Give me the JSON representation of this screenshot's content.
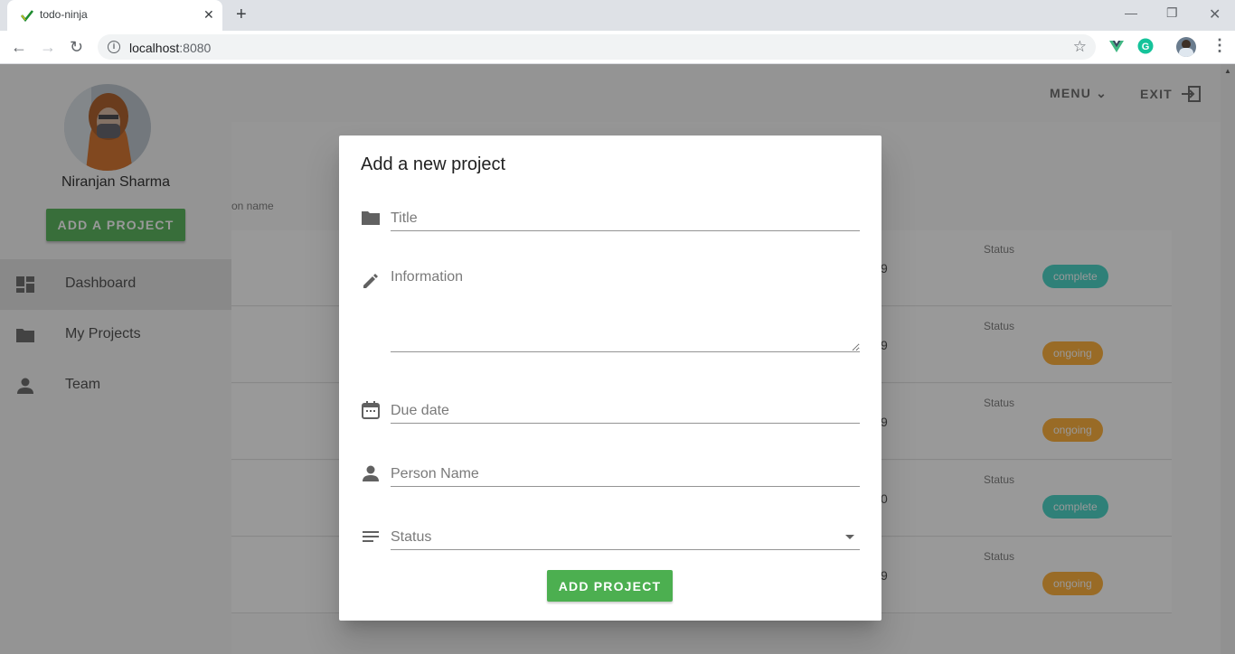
{
  "browser": {
    "tab_title": "todo-ninja",
    "url_host": "localhost",
    "url_port": ":8080"
  },
  "app": {
    "menu_label": "MENU",
    "exit_label": "EXIT",
    "column_header": "on name",
    "rows": [
      {
        "status_label": "Status",
        "date_fragment": "9",
        "status": "complete"
      },
      {
        "status_label": "Status",
        "date_fragment": "9",
        "status": "ongoing"
      },
      {
        "status_label": "Status",
        "date_fragment": "9",
        "status": "ongoing"
      },
      {
        "status_label": "Status",
        "date_fragment": "0",
        "status": "complete"
      },
      {
        "status_label": "Status",
        "date_fragment": "9",
        "status": "ongoing"
      }
    ]
  },
  "drawer": {
    "user_name": "Niranjan Sharma",
    "add_button": "ADD A PROJECT",
    "items": [
      {
        "label": "Dashboard",
        "icon": "dashboard-icon",
        "active": true
      },
      {
        "label": "My Projects",
        "icon": "folder-icon",
        "active": false
      },
      {
        "label": "Team",
        "icon": "person-icon",
        "active": false
      }
    ]
  },
  "dialog": {
    "title": "Add a new project",
    "fields": {
      "title": {
        "placeholder": "Title",
        "value": ""
      },
      "information": {
        "placeholder": "Information",
        "value": ""
      },
      "due_date": {
        "placeholder": "Due date",
        "value": ""
      },
      "person_name": {
        "placeholder": "Person Name",
        "value": ""
      },
      "status": {
        "placeholder": "Status",
        "value": ""
      }
    },
    "submit_label": "ADD PROJECT"
  },
  "colors": {
    "primary_green": "#4caf50",
    "complete_chip": "#3cd1c2",
    "ongoing_chip": "#ffaa2c"
  }
}
